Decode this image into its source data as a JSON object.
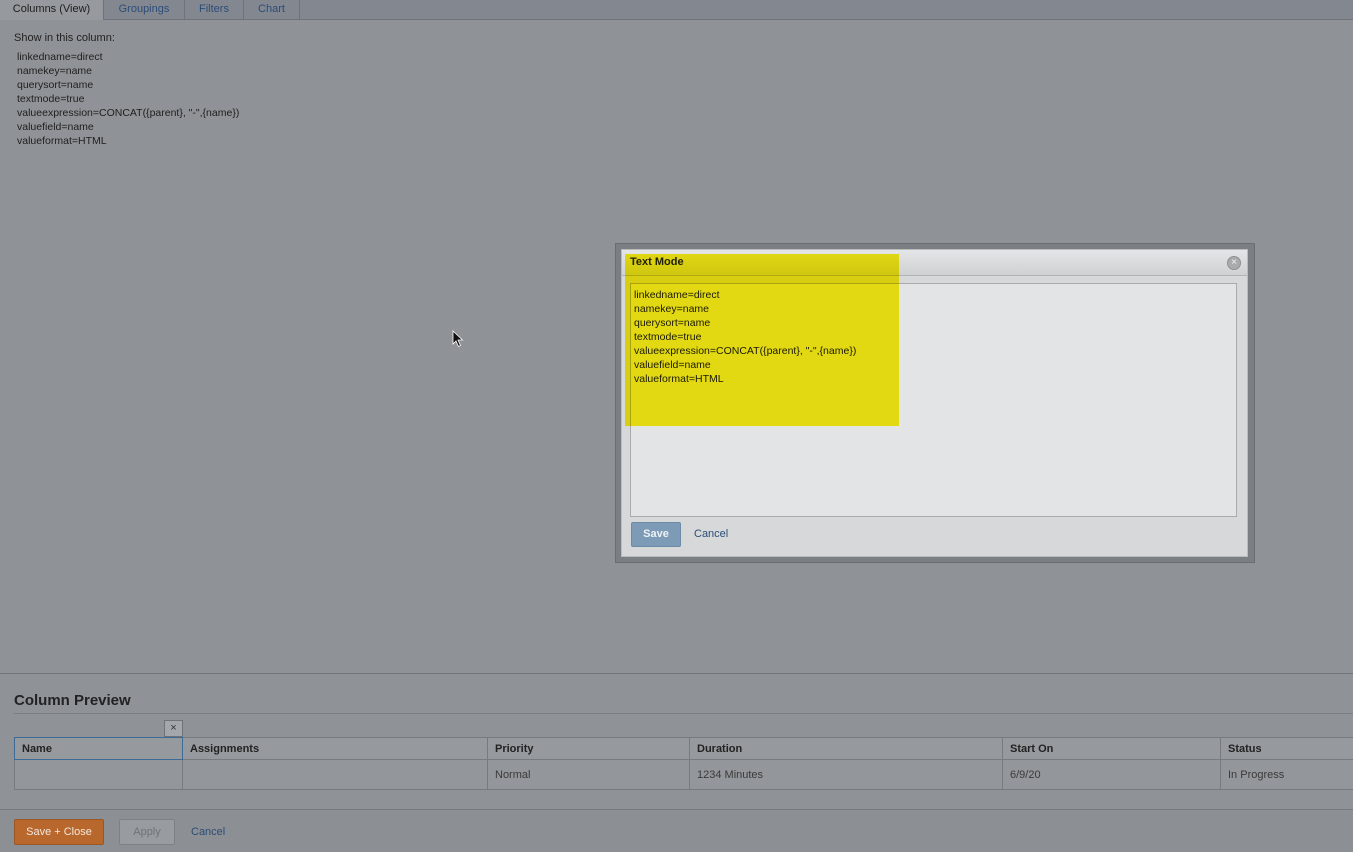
{
  "tabs": [
    {
      "label": "Columns (View)",
      "active": true
    },
    {
      "label": "Groupings",
      "active": false
    },
    {
      "label": "Filters",
      "active": false
    },
    {
      "label": "Chart",
      "active": false
    }
  ],
  "column_config": {
    "show_label": "Show in this column:",
    "lines": [
      "linkedname=direct",
      "namekey=name",
      "querysort=name",
      "textmode=true",
      "valueexpression=CONCAT({parent}, \"-\",{name})",
      "valuefield=name",
      "valueformat=HTML"
    ]
  },
  "modal": {
    "title": "Text Mode",
    "close_icon": "close-circle-icon",
    "text_lines": [
      "linkedname=direct",
      "namekey=name",
      "querysort=name",
      "textmode=true",
      "valueexpression=CONCAT({parent}, \"-\",{name})",
      "valuefield=name",
      "valueformat=HTML"
    ],
    "save_label": "Save",
    "cancel_label": "Cancel"
  },
  "preview": {
    "title": "Column Preview",
    "remove_label": "×",
    "columns": [
      "Name",
      "Assignments",
      "Priority",
      "Duration",
      "Start On",
      "Status"
    ],
    "row": [
      "",
      "",
      "Normal",
      "1234 Minutes",
      "6/9/20",
      "In Progress"
    ]
  },
  "footer": {
    "save_close_label": "Save + Close",
    "apply_label": "Apply",
    "cancel_label": "Cancel"
  },
  "colors": {
    "overlay": "#8f9296",
    "accent_orange": "#b9682d",
    "link_blue": "#2c4d77",
    "highlight_yellow": "#fff200"
  }
}
